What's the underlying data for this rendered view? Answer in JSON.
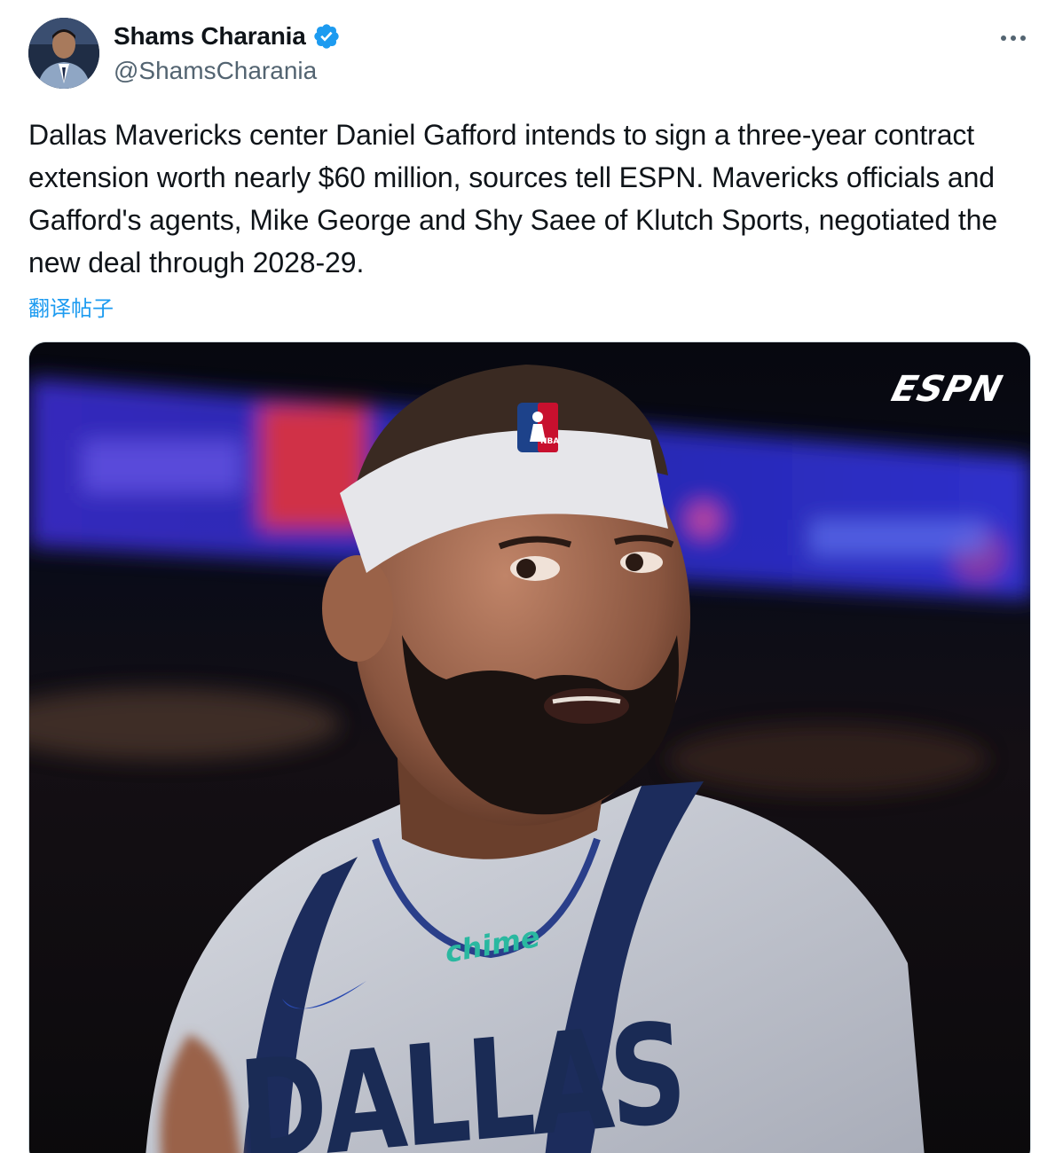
{
  "author": {
    "display_name": "Shams Charania",
    "handle": "@ShamsCharania",
    "verified": true,
    "avatar_icon": "avatar-photo"
  },
  "more_icon": "more-horizontal-icon",
  "post": {
    "text": "Dallas Mavericks center Daniel Gafford intends to sign a three-year contract extension worth nearly $60 million, sources tell ESPN. Mavericks officials and Gafford's agents, Mike George and Shy Saee of Klutch Sports, negotiated the new deal through 2028-29.",
    "translate_label": "翻译帖子"
  },
  "media": {
    "watermark": "ESPN",
    "headband_logo": "NBA",
    "jersey_sponsor": "chime",
    "jersey_wordmark": "DALLAS"
  },
  "colors": {
    "verified_blue": "#1d9bf0",
    "link_blue": "#1d9bf0",
    "secondary_text": "#536471",
    "primary_text": "#0f1419"
  }
}
